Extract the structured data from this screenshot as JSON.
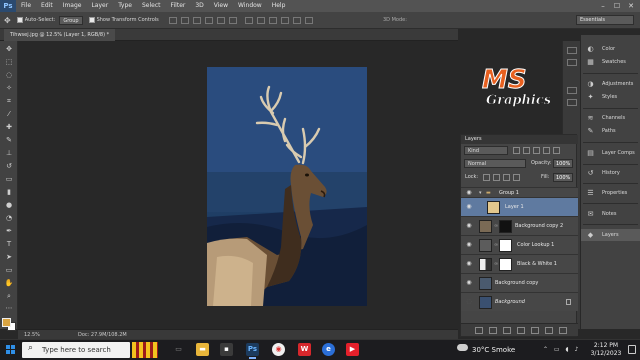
{
  "app": {
    "logo": "Ps"
  },
  "menu": [
    "File",
    "Edit",
    "Image",
    "Layer",
    "Type",
    "Select",
    "Filter",
    "3D",
    "View",
    "Window",
    "Help"
  ],
  "window_controls": [
    "–",
    "☐",
    "✕"
  ],
  "options": {
    "auto_select_label": "Auto-Select:",
    "auto_select_value": "Group",
    "transform_label": "Show Transform Controls",
    "mode_3d": "3D Mode:",
    "workspace": "Essentials"
  },
  "document": {
    "tab_title": "Tihwsej.jpg @ 12.5% (Layer 1, RGB/8) *",
    "zoom": "12.5%",
    "doc_size": "Doc: 27.9M/108.2M"
  },
  "colors": {
    "foreground": "#d9a441",
    "background": "#ffffff",
    "selected_layer": "#5f7aa0"
  },
  "right_panel": [
    {
      "icon": "color-icon",
      "glyph": "◐",
      "label": "Color"
    },
    {
      "icon": "swatches-icon",
      "glyph": "▦",
      "label": "Swatches"
    },
    {
      "icon": "adjustments-icon",
      "glyph": "◑",
      "label": "Adjustments"
    },
    {
      "icon": "styles-icon",
      "glyph": "✦",
      "label": "Styles"
    },
    {
      "icon": "channels-icon",
      "glyph": "≋",
      "label": "Channels"
    },
    {
      "icon": "paths-icon",
      "glyph": "✎",
      "label": "Paths"
    },
    {
      "icon": "layer-comps-icon",
      "glyph": "▤",
      "label": "Layer Comps"
    },
    {
      "icon": "history-icon",
      "glyph": "↺",
      "label": "History"
    },
    {
      "icon": "properties-icon",
      "glyph": "☰",
      "label": "Properties"
    },
    {
      "icon": "notes-icon",
      "glyph": "✉",
      "label": "Notes"
    },
    {
      "icon": "layers-icon",
      "glyph": "◆",
      "label": "Layers"
    }
  ],
  "layers_panel": {
    "tab": "Layers",
    "kind": "Kind",
    "blend_mode": "Normal",
    "opacity_label": "Opacity:",
    "opacity": "100%",
    "lock_label": "Lock:",
    "fill_label": "Fill:",
    "fill": "100%",
    "layers": [
      {
        "name": "Group 1",
        "type": "group"
      },
      {
        "name": "Layer 1",
        "type": "pixel",
        "selected": true
      },
      {
        "name": "Background copy 2",
        "type": "masked"
      },
      {
        "name": "Color Lookup 1",
        "type": "adjustment"
      },
      {
        "name": "Black & White 1",
        "type": "adjustment"
      },
      {
        "name": "Background copy",
        "type": "pixel"
      },
      {
        "name": "Background",
        "type": "background"
      }
    ]
  },
  "watermark": {
    "brand": "MS",
    "sub": "Graphics"
  },
  "taskbar": {
    "search_placeholder": "Type here to search",
    "weather": "30°C  Smoke",
    "time": "2:12 PM",
    "date": "3/12/2023"
  }
}
